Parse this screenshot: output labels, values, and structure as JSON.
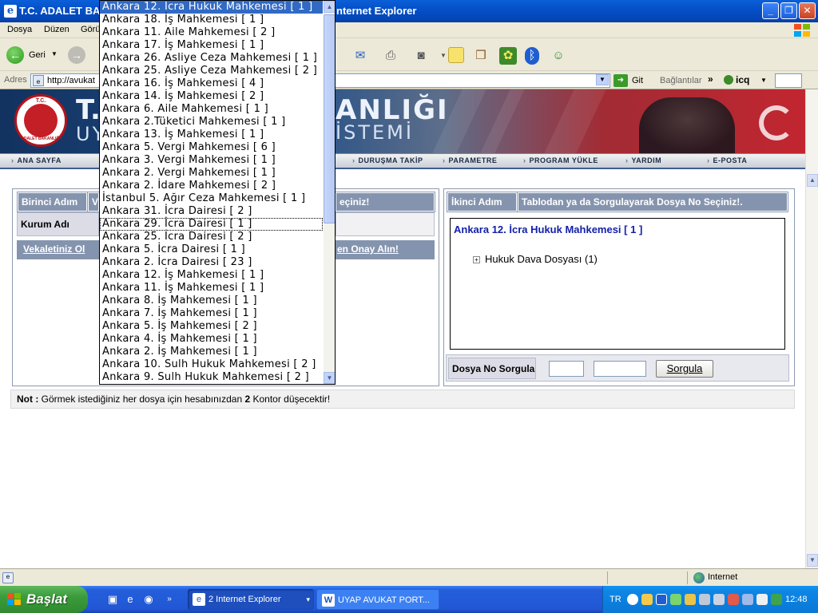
{
  "window": {
    "title_left": "T.C. ADALET BAK",
    "title_right": "nternet Explorer",
    "minimize": "_",
    "maximize": "❐",
    "close": "✕"
  },
  "menubar": {
    "items": [
      "Dosya",
      "Düzen",
      "Görü"
    ]
  },
  "toolbar": {
    "back_label": "Geri"
  },
  "addressbar": {
    "label": "Adres",
    "url": "http://avukat",
    "go_label": "Git",
    "links_label": "Bağlantılar",
    "links_chevron": "»",
    "icq_label": "icq"
  },
  "banner": {
    "text_left": "T.",
    "text_top": "ANLIĞI",
    "text_left2": "UYA",
    "text_bottom": "İSTEMİ",
    "seal_top": "T.C.",
    "seal_bottom": "ADALET BAKANLIĞI"
  },
  "nav": {
    "items": [
      "ANA SAYFA",
      "DURUŞMA TAKİP",
      "PARAMETRE",
      "PROGRAM YÜKLE",
      "YARDIM",
      "E-POSTA"
    ]
  },
  "left_panel": {
    "step_header": "Birinci Adım",
    "step_tail": "V",
    "header_right": "eçiniz!",
    "kurum_label": "Kurum Adı",
    "link_left": "Vekaletiniz Ol",
    "link_right": "en Onay Alın!"
  },
  "right_panel": {
    "step_header": "İkinci Adım",
    "step_instruction": "Tablodan ya da Sorgulayarak Dosya No Seçiniz!.",
    "court_title": "Ankara 12. İcra Hukuk Mahkemesi [ 1 ]",
    "tree_expander": "+",
    "tree_node": "Hukuk Dava Dosyası (1)",
    "query_label": "Dosya No Sorgula",
    "query_button": "Sorgula"
  },
  "note": {
    "bold": "Not :",
    "text": " Görmek istediğiniz her dosya için hesabınızdan ",
    "count": "2",
    "tail": " Kontor düşecektir!"
  },
  "dropdown": {
    "selected_index": 0,
    "hover_index": 17,
    "items": [
      "Ankara 12. İcra Hukuk Mahkemesi [ 1 ]",
      "Ankara 18. İş Mahkemesi [ 1 ]",
      "Ankara 11. Aile Mahkemesi [ 2 ]",
      "Ankara 17. İş Mahkemesi [ 1 ]",
      "Ankara 26. Asliye Ceza Mahkemesi [ 1 ]",
      "Ankara 25. Asliye Ceza Mahkemesi [ 2 ]",
      "Ankara 16. İş Mahkemesi [ 4 ]",
      "Ankara 14. İş Mahkemesi [ 2 ]",
      "Ankara 6. Aile Mahkemesi [ 1 ]",
      "Ankara 2.Tüketici Mahkemesi [ 1 ]",
      "Ankara 13. İş Mahkemesi [ 1 ]",
      "Ankara 5. Vergi Mahkemesi [ 6 ]",
      "Ankara 3. Vergi Mahkemesi [ 1 ]",
      "Ankara 2. Vergi Mahkemesi [ 1 ]",
      "Ankara 2. İdare Mahkemesi [ 2 ]",
      "İstanbul 5. Ağır Ceza Mahkemesi [ 1 ]",
      "Ankara 31. İcra Dairesi [ 2 ]",
      "Ankara 29. İcra Dairesi [ 1 ]",
      "Ankara 25. İcra Dairesi [ 2 ]",
      "Ankara 5. İcra Dairesi [ 1 ]",
      "Ankara 2. İcra Dairesi [ 23 ]",
      "Ankara 12. İş Mahkemesi [ 1 ]",
      "Ankara 11. İş Mahkemesi [ 1 ]",
      "Ankara 8. İş Mahkemesi [ 1 ]",
      "Ankara 7. İş Mahkemesi [ 1 ]",
      "Ankara 5. İş Mahkemesi [ 2 ]",
      "Ankara 4. İş Mahkemesi [ 1 ]",
      "Ankara 2. İş Mahkemesi [ 1 ]",
      "Ankara 10. Sulh Hukuk Mahkemesi [ 2 ]",
      "Ankara 9. Sulh Hukuk Mahkemesi [ 2 ]"
    ]
  },
  "statusbar": {
    "zone": "Internet"
  },
  "taskbar": {
    "start_label": "Başlat",
    "ql_chevron": "»",
    "ie_task": "2 Internet Explorer",
    "ie_task_arrow": "▾",
    "word_task": "UYAP AVUKAT PORT...",
    "lang": "TR",
    "clock": "12:48"
  },
  "colors": {
    "selection": "#316ac5",
    "panel_header": "#8594ae",
    "court_title": "#1420a8"
  }
}
